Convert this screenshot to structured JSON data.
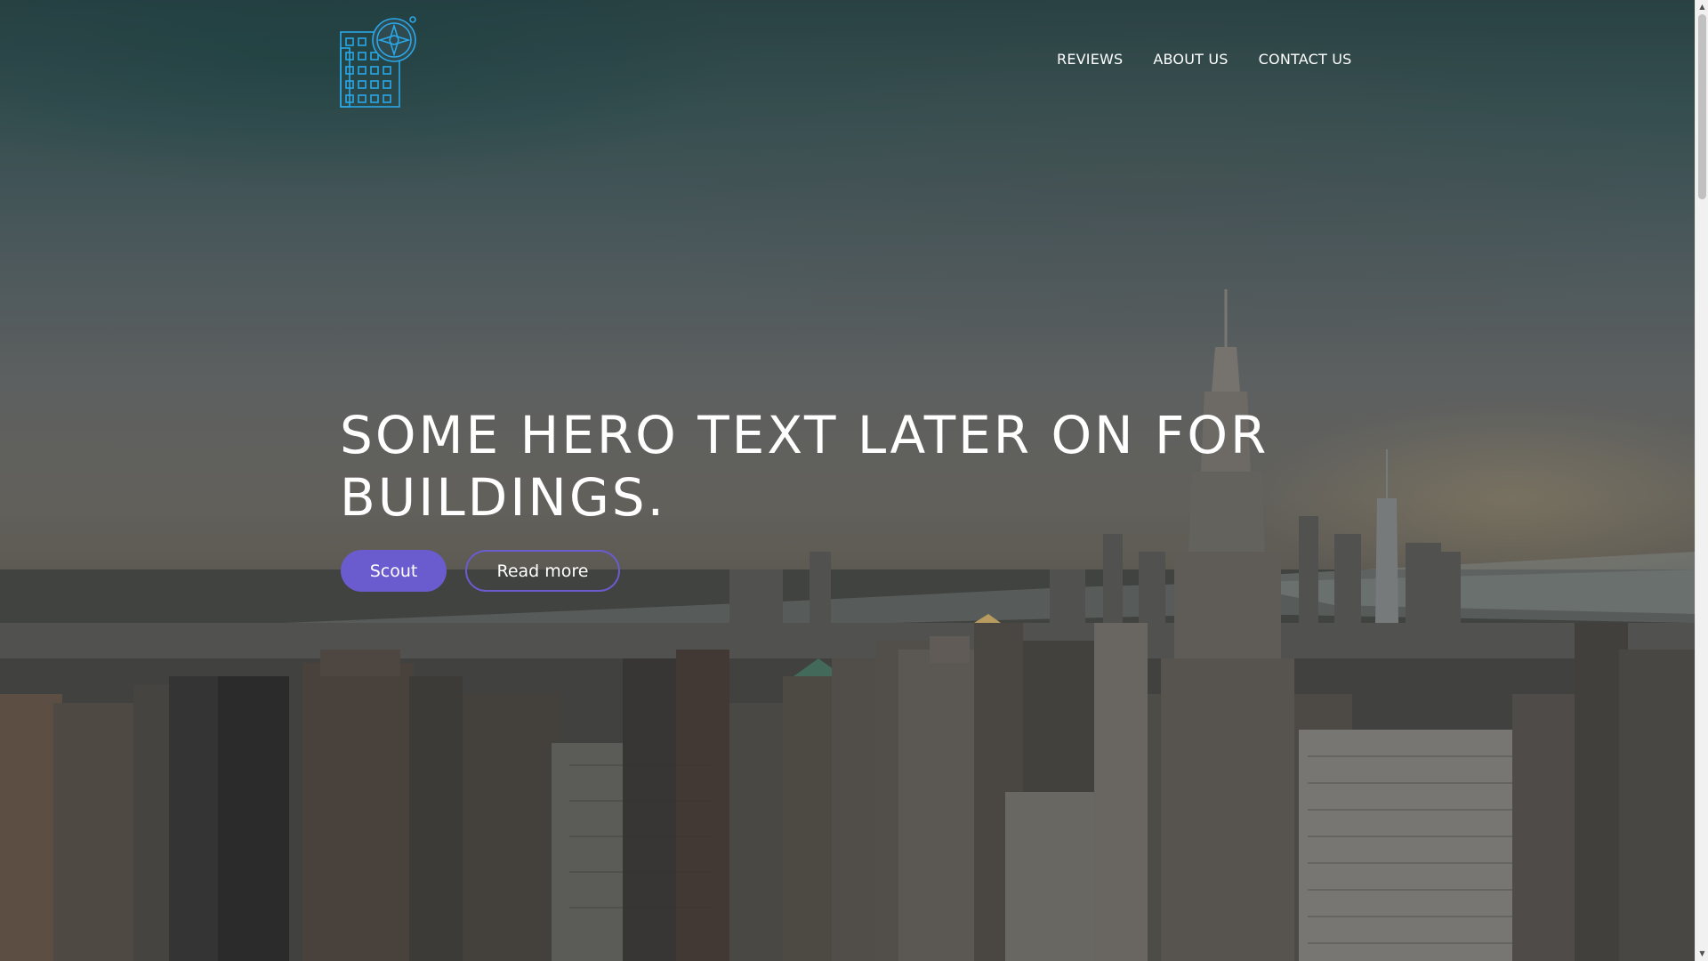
{
  "colors": {
    "accent": "#6a5ccf",
    "logo": "#2aa7e8",
    "nav_text": "#ffffff",
    "scrollbar_thumb": "#c1c1c1"
  },
  "logo": {
    "icon": "building-compass-logo"
  },
  "nav": {
    "items": [
      {
        "label": "REVIEWS"
      },
      {
        "label": "ABOUT US"
      },
      {
        "label": "CONTACT US"
      }
    ]
  },
  "hero": {
    "title": "SOME HERO TEXT LATER ON FOR BUILDINGS.",
    "primary_button": "Scout",
    "secondary_button": "Read more"
  },
  "background": {
    "icon": "city-skyline-photo"
  }
}
